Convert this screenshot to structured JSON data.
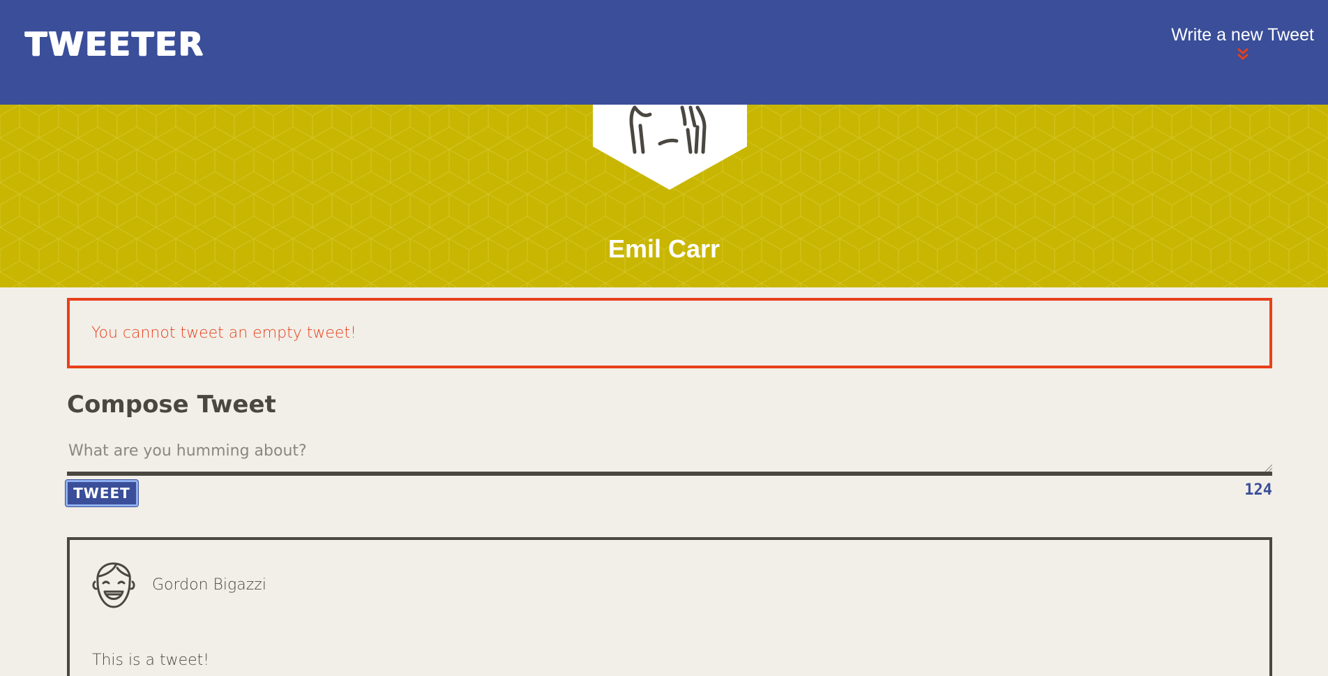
{
  "nav": {
    "brand": "TWEETER",
    "compose_link": "Write a new Tweet",
    "compose_link_icon": "double-chevron-down-icon"
  },
  "profile": {
    "name": "Emil Carr",
    "avatar_icon": "user-avatar-icon"
  },
  "error": {
    "message": "You cannot tweet an empty tweet!"
  },
  "compose": {
    "title": "Compose Tweet",
    "placeholder": "What are you humming about?",
    "value": "",
    "button_label": "TWEET",
    "counter": "124"
  },
  "tweets": [
    {
      "author": "Gordon Bigazzi",
      "avatar_icon": "smiling-face-avatar-icon",
      "text": "This is a tweet!"
    }
  ],
  "colors": {
    "nav_bg": "#3a4e99",
    "band_bg": "#c8b602",
    "page_bg": "#f2efe9",
    "error": "#e8401a",
    "text": "#4a4741",
    "accent": "#3a4e99"
  }
}
